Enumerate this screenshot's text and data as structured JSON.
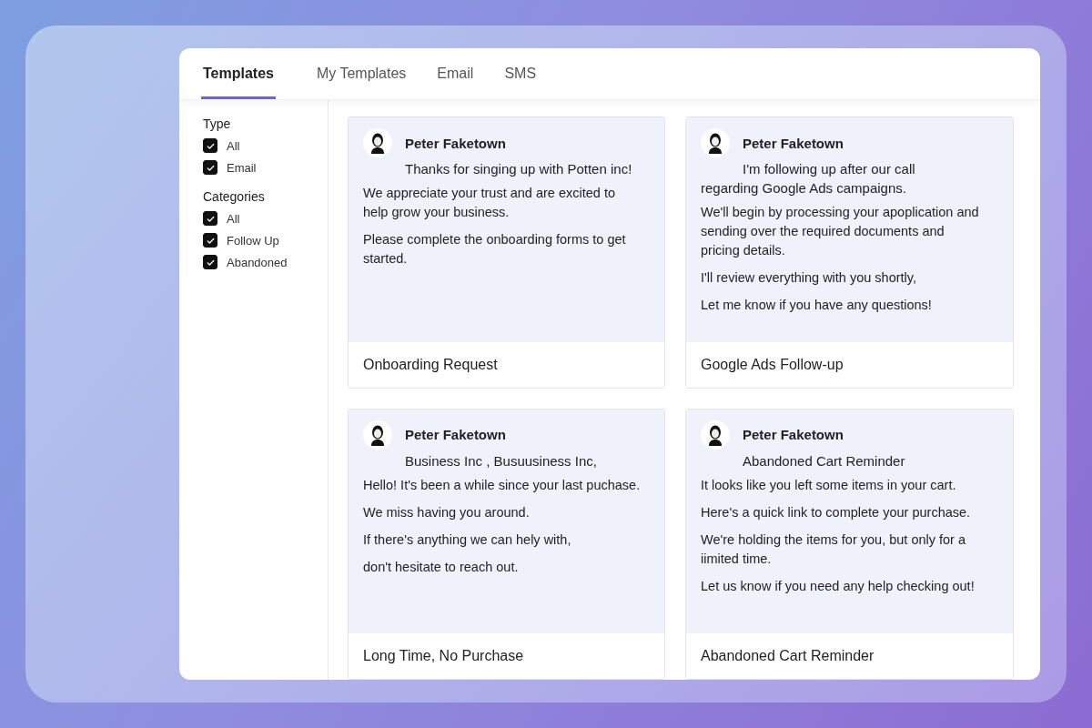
{
  "tabs": [
    {
      "label": "Templates",
      "selected": true
    },
    {
      "label": "My Templates",
      "selected": false
    },
    {
      "label": "Email",
      "selected": false
    },
    {
      "label": "SMS",
      "selected": false
    }
  ],
  "filters": [
    {
      "heading": "Type",
      "options": [
        {
          "label": "All",
          "checked": true
        },
        {
          "label": "Email",
          "checked": true
        }
      ]
    },
    {
      "heading": "Categories",
      "options": [
        {
          "label": "All",
          "checked": true
        },
        {
          "label": "Follow Up",
          "checked": true
        },
        {
          "label": "Abandoned",
          "checked": true
        }
      ]
    }
  ],
  "templates": [
    {
      "sender": "Peter Faketown",
      "subject": "Thanks for singing up with Potten inc!",
      "paragraphs": [
        "We appreciate your trust and are excited to help grow your business.",
        "Please complete the onboarding forms to get started."
      ],
      "title": "Onboarding Request"
    },
    {
      "sender": "Peter Faketown",
      "subject": "I'm following up after our call regarding Google Ads campaigns.",
      "paragraphs": [
        "We'll begin by processing your apoplication and sending over the required documents and pricing details.",
        "I'll review everything with you shortly,",
        "Let me know if you have any questions!"
      ],
      "title": "Google Ads Follow-up"
    },
    {
      "sender": "Peter Faketown",
      "subject": "Business Inc , Busuusiness Inc,",
      "paragraphs": [
        "Hello! It's been a while since your last puchase.",
        "We miss having you around.",
        "If there's anything we can hely with,",
        "don't hesitate to reach out."
      ],
      "title": "Long Time, No Purchase"
    },
    {
      "sender": "Peter Faketown",
      "subject": "Abandoned Cart Reminder",
      "paragraphs": [
        "It looks like you left some items in your cart.",
        "Here's a quick link to complete your purchase.",
        "We're holding the items for you, but only for a iimited time.",
        "Let us know if you need any help checking out!"
      ],
      "title": "Abandoned Cart Reminder"
    }
  ]
}
